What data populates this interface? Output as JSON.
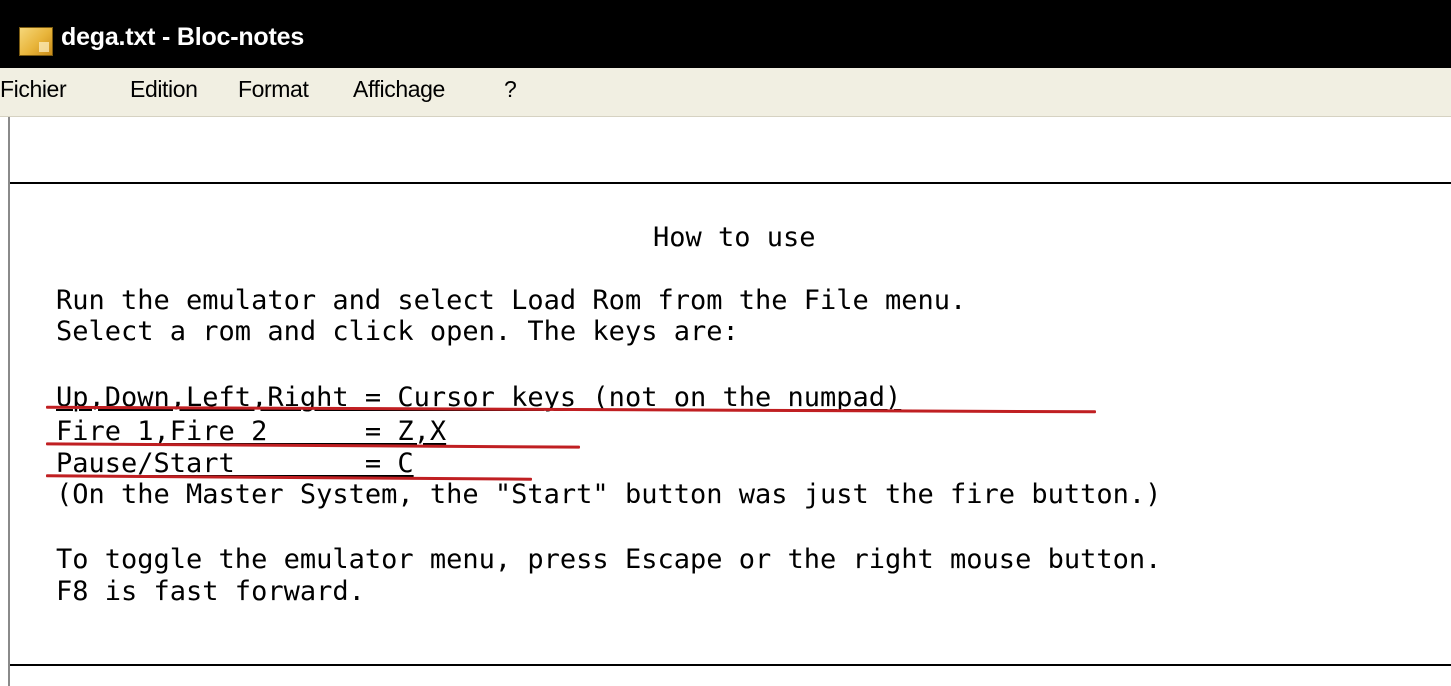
{
  "window": {
    "title": "dega.txt - Bloc-notes",
    "icon": "notepad-icon"
  },
  "menu": {
    "items": [
      "Fichier",
      "Edition",
      "Format",
      "Affichage",
      "?"
    ]
  },
  "document": {
    "heading": "How to use",
    "intro_line_1": "Run the emulator and select Load Rom from the File menu.",
    "intro_line_2": "Select a rom and click open. The keys are:",
    "keys": [
      "Up,Down,Left,Right = Cursor keys (not on the numpad)",
      "Fire 1,Fire 2      = Z,X",
      "Pause/Start        = C"
    ],
    "note": "(On the Master System, the \"Start\" button was just the fire button.)",
    "toggle_line_1": "To toggle the emulator menu, press Escape or the right mouse button.",
    "toggle_line_2": "F8 is fast forward."
  },
  "colors": {
    "titlebar": "#000000",
    "menubar": "#f1efe2",
    "annotation_red": "#c01f22"
  }
}
